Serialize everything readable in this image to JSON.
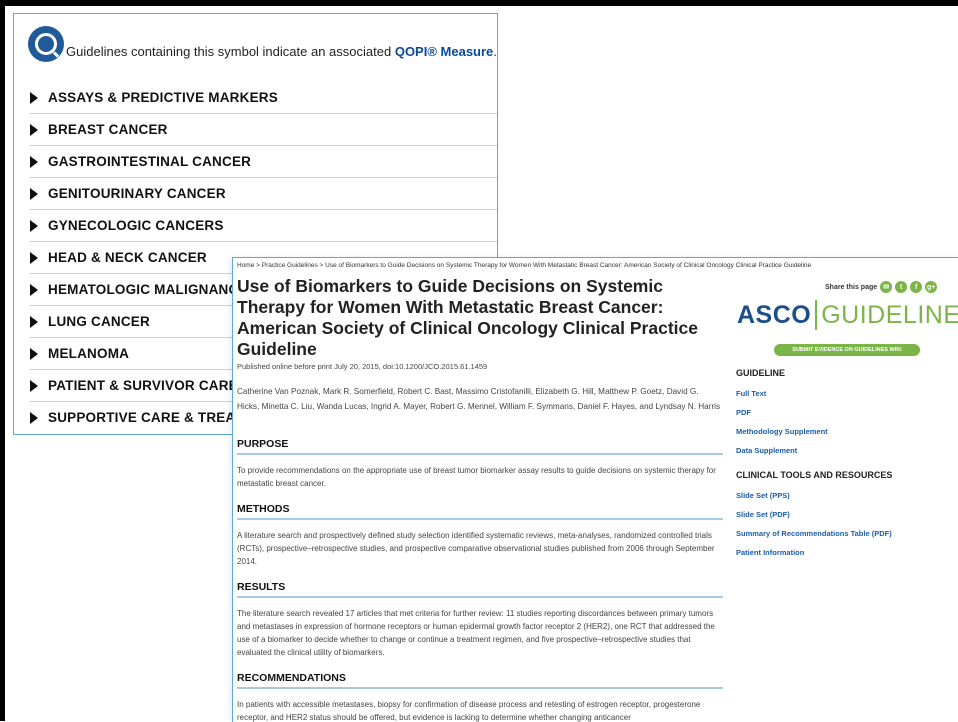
{
  "qopi": {
    "text": "Guidelines containing this symbol indicate an associated",
    "link": "QOPI® Measure",
    "period": "."
  },
  "categories": [
    "ASSAYS & PREDICTIVE MARKERS",
    "BREAST CANCER",
    "GASTROINTESTINAL CANCER",
    "GENITOURINARY CANCER",
    "GYNECOLOGIC CANCERS",
    "HEAD & NECK CANCER",
    "HEMATOLOGIC MALIGNANCIES",
    "LUNG CANCER",
    "MELANOMA",
    "PATIENT & SURVIVOR CARE",
    "SUPPORTIVE CARE & TREATMENT"
  ],
  "article": {
    "breadcrumb": "Home > Practice Guidelines > Use of Biomarkers to Guide Decisions on Systemic Therapy for Women With Metastatic Breast Cancer: American Society of Clinical Oncology Clinical Practice Guideline",
    "title": "Use of Biomarkers to Guide Decisions on Systemic Therapy for Women With Metastatic Breast Cancer: American Society of Clinical Oncology Clinical Practice Guideline",
    "pubinfo": "Published online before print July 20, 2015, doi:10.1200/JCO.2015.61.1459",
    "authors": "Catherine Van Poznak, Mark R. Somerfield, Robert C. Bast, Massimo Cristofanilli, Elizabeth G. Hill, Matthew P. Goetz, David G. Hicks, Minetta C. Liu, Wanda Lucas, Ingrid A. Mayer, Robert G. Mennel, William F. Symmans, Daniel F. Hayes, and Lyndsay N. Harris",
    "sections": [
      {
        "heading": "PURPOSE",
        "text": "To provide recommendations on the appropriate use of breast tumor biomarker assay results to guide decisions on systemic therapy for metastatic breast cancer."
      },
      {
        "heading": "METHODS",
        "text": "A literature search and prospectively defined study selection identified systematic reviews, meta-analyses, randomized controlled trials (RCTs), prospective–retrospective studies, and prospective comparative observational studies published from 2006 through September 2014."
      },
      {
        "heading": "RESULTS",
        "text": "The literature search revealed 17 articles that met criteria for further review: 11 studies reporting discordances between primary tumors and metastases in expression of hormone receptors or human epidermal growth factor receptor 2 (HER2), one RCT that addressed the use of a biomarker to decide whether to change or continue a treatment regimen, and five prospective–retrospective studies that evaluated the clinical utility of biomarkers."
      },
      {
        "heading": "RECOMMENDATIONS",
        "text": "In patients with accessible metastases, biopsy for confirmation of disease process and retesting of estrogen receptor, progesterone receptor, and HER2 status should be offered, but evidence is lacking to determine whether changing anticancer"
      }
    ]
  },
  "sidebar": {
    "share_label": "Share this page",
    "share_icons": [
      "✉",
      "t",
      "f",
      "g+"
    ],
    "logo_left": "ASCO",
    "logo_right": "GUIDELINES",
    "wiki_button": "SUBMIT EVIDENCE ON GUIDELINES WIKI",
    "guideline_heading": "GUIDELINE",
    "guideline_links": [
      "Full Text",
      "PDF",
      "Methodology Supplement",
      "Data Supplement"
    ],
    "tools_heading": "CLINICAL TOOLS AND RESOURCES",
    "tools_links": [
      "Slide Set (PPS)",
      "Slide Set (PDF)",
      "Summary of Recommendations Table (PDF)",
      "Patient Information"
    ]
  },
  "colors": {
    "accent_blue": "#1b5ea8",
    "brand_green": "#7bb547",
    "panel_border": "#5aa9d8"
  }
}
